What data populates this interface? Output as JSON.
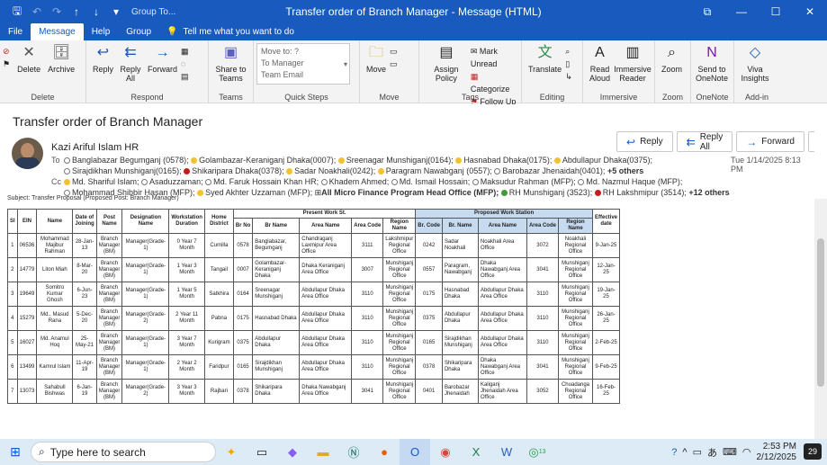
{
  "window": {
    "group_label": "Group To...",
    "title": "Transfer order of Branch Manager  -  Message (HTML)"
  },
  "tabs": [
    "File",
    "Message",
    "Help",
    "Group"
  ],
  "tell_me": "Tell me what you want to do",
  "ribbon": {
    "groups": {
      "delete": "Delete",
      "respond": "Respond",
      "teams": "Teams",
      "quick_steps": "Quick Steps",
      "move": "Move",
      "tags": "Tags",
      "editing": "Editing",
      "immersive": "Immersive",
      "zoom": "Zoom",
      "onenote": "OneNote",
      "addin": "Add-in"
    },
    "buttons": {
      "delete": "Delete",
      "archive": "Archive",
      "reply": "Reply",
      "reply_all": "Reply All",
      "forward": "Forward",
      "share_teams": "Share to Teams",
      "move": "Move",
      "assign_policy": "Assign Policy",
      "mark_unread": "Mark Unread",
      "categorize": "Categorize",
      "follow_up": "Follow Up",
      "translate": "Translate",
      "read_aloud": "Read Aloud",
      "immersive_reader": "Immersive Reader",
      "zoom": "Zoom",
      "send_onenote": "Send to OneNote",
      "viva": "Viva Insights"
    },
    "quick_steps": [
      "Move to: ?",
      "To Manager",
      "Team Email"
    ]
  },
  "message": {
    "subject": "Transfer order of Branch Manager",
    "sender": "Kazi Ariful Islam HR",
    "datetime": "Tue 1/14/2025 8:13 PM",
    "to_label": "To",
    "cc_label": "Cc",
    "to_line1": [
      {
        "name": "Banglabazar Begumganj (0578);",
        "status": "empty"
      },
      {
        "name": "Golambazar-Keraniganj  Dhaka(0007);",
        "status": "yellow"
      },
      {
        "name": "Sreenagar Munshiganj(0164);",
        "status": "yellow"
      },
      {
        "name": "Hasnabad Dhaka(0175);",
        "status": "yellow"
      },
      {
        "name": "Abdullapur Dhaka(0375);",
        "status": "yellow"
      }
    ],
    "to_line2": [
      {
        "name": "Sirajdikhan Munshiganj(0165);",
        "status": "empty"
      },
      {
        "name": "Shikaripara Dhaka(0378);",
        "status": "red"
      },
      {
        "name": "Sadar Noakhali(0242);",
        "status": "yellow"
      },
      {
        "name": "Paragram Nawabganj (0557);",
        "status": "yellow"
      },
      {
        "name": "Barobazar Jhenaidah(0401);",
        "status": "empty"
      }
    ],
    "to_more": "+5 others",
    "cc_line1": [
      {
        "name": "Md. Shariful Islam;",
        "status": "yellow"
      },
      {
        "name": "Asaduzzaman;",
        "status": "empty"
      },
      {
        "name": "Md. Faruk Hossain Khan HR;",
        "status": "empty"
      },
      {
        "name": "Khadem Ahmed;",
        "status": "empty"
      },
      {
        "name": "Md. Ismail  Hossain;",
        "status": "empty"
      },
      {
        "name": "Maksudur Rahman (MFP);",
        "status": "empty"
      },
      {
        "name": "Md. Nazmul Haque (MFP);",
        "status": "empty"
      }
    ],
    "cc_line2": [
      {
        "name": "Mohammad Shibbir Hasan (MFP);",
        "status": "empty"
      },
      {
        "name": "Syed Akhter Uzzaman (MFP);",
        "status": "yellow"
      }
    ],
    "cc_group": "All Micro Finance Program Head Office (MFP);",
    "cc_line2b": [
      {
        "name": "RH Munshiganj (3523);",
        "status": "green"
      },
      {
        "name": "RH Lakshmipur (3514);",
        "status": "red"
      }
    ],
    "cc_more": "+12 others",
    "actions": {
      "reply": "Reply",
      "reply_all": "Reply All",
      "forward": "Forward"
    },
    "body_subject": "Subject: Transfer Proposal (Proposed Post: Branch Manager)"
  },
  "table": {
    "present_header": "Present Work St.",
    "proposed_header": "Proposed Work Station",
    "headers": [
      "Sl",
      "EIN",
      "Name",
      "Date of Joining",
      "Post Name",
      "Designation Name",
      "Workstation Duration",
      "Home District",
      "Br No",
      "Br Name",
      "Area Name",
      "Area Code",
      "Region Name",
      "Br. Code",
      "Br. Name",
      "Area Name",
      "Area Code",
      "Region Name",
      "Effective date"
    ],
    "rows": [
      [
        "1",
        "06536",
        "Mohammad Majibur Rahman",
        "28-Jan-13",
        "Branch Manager (BM)",
        "Manager(Grade-1)",
        "0 Year 7 Month",
        "Cumilla",
        "0578",
        "Banglabazar, Begumganj",
        "Chandraganj Laxmipur Area Office",
        "3111",
        "Lakshmipur Regional Office",
        "0242",
        "Sadar Noakhali",
        "Noakhali Area Office",
        "3072",
        "Noakhali Regional Office",
        "9-Jan-25"
      ],
      [
        "2",
        "14779",
        "Liton Miah",
        "8-Mar-20",
        "Branch Manager (BM)",
        "Manager(Grade-1)",
        "1 Year 3 Month",
        "Tangail",
        "0007",
        "Golambazar-Keraniganj Dhaka",
        "Dhaka Keraniganj Area Office",
        "3007",
        "Munshiganj Regional Office",
        "0557",
        "Paragram, Nawabganj",
        "Dhaka Nawabganj Area Office",
        "3041",
        "Munshiganj Regional Office",
        "12-Jan-25"
      ],
      [
        "3",
        "19649",
        "Somitro Kumar Ghosh",
        "6-Jun-23",
        "Branch Manager (BM)",
        "Manager(Grade-1)",
        "1 Year 5 Month",
        "Satkhira",
        "0164",
        "Sreenagar Munshiganj",
        "Abdullapur Dhaka Area Office",
        "3110",
        "Munshiganj Regional Office",
        "0175",
        "Hasnabad Dhaka",
        "Abdullapur Dhaka Area Office",
        "3110",
        "Munshiganj Regional Office",
        "19-Jan-25"
      ],
      [
        "4",
        "15279",
        "Md., Masud Rana",
        "5-Dec-20",
        "Branch Manager (BM)",
        "Manager(Grade-2)",
        "2 Year 11 Month",
        "Pabna",
        "0175",
        "Hasnabad Dhaka",
        "Abdullapur Dhaka Area Office",
        "3110",
        "Munshiganj Regional Office",
        "0375",
        "Abdullapur Dhaka",
        "Abdullapur Dhaka Area Office",
        "3110",
        "Munshiganj Regional Office",
        "26-Jan-25"
      ],
      [
        "5",
        "16027",
        "Md. Anamul Hoq",
        "25-May-21",
        "Branch Manager (BM)",
        "Manager(Grade-1)",
        "3 Year 7 Month",
        "Kurigram",
        "0375",
        "Abdullapur Dhaka",
        "Abdullapur Dhaka Area Office",
        "3110",
        "Munshiganj Regional Office",
        "0165",
        "Sirajdikhan Munshiganj",
        "Abdullapur Dhaka Area Office",
        "3110",
        "Munshiganj Regional Office",
        "2-Feb-25"
      ],
      [
        "6",
        "13499",
        "Kamrul Islam",
        "11-Apr-19",
        "Branch Manager (BM)",
        "Manager(Grade-1)",
        "2 Year 2 Month",
        "Faridpur",
        "0165",
        "Sirajdikhan Munshiganj",
        "Abdullapur Dhaka Area Office",
        "3110",
        "Munshiganj Regional Office",
        "0378",
        "Shikaripara Dhaka",
        "Dhaka Nawabganj Area Office",
        "3041",
        "Munshiganj Regional Office",
        "9-Feb-25"
      ],
      [
        "7",
        "13073",
        "Sahabull Bishwas",
        "6-Jan-19",
        "Branch Manager (BM)",
        "Manager(Grade-2)",
        "3 Year 3 Month",
        "Rajbari",
        "0378",
        "Shikaripara Dhaka",
        "Dhaka Nawabganj Area Office",
        "3041",
        "Munshiganj Regional Office",
        "0401",
        "Barobazar Jhenaidah",
        "Kaliganj Jhenaidah Area Office",
        "3052",
        "Chuadanga Regional Office",
        "16-Feb-25"
      ]
    ]
  },
  "taskbar": {
    "search_placeholder": "Type here to search",
    "time": "2:53 PM",
    "date": "2/12/2025",
    "notifications": "29",
    "whatsapp_badge": "13"
  },
  "colors": {
    "brand": "#185abd",
    "proposed_header_bg": "#c6daf0",
    "presence_yellow": "#f2c230",
    "presence_red": "#c91b1b",
    "presence_green": "#3f9b35"
  }
}
